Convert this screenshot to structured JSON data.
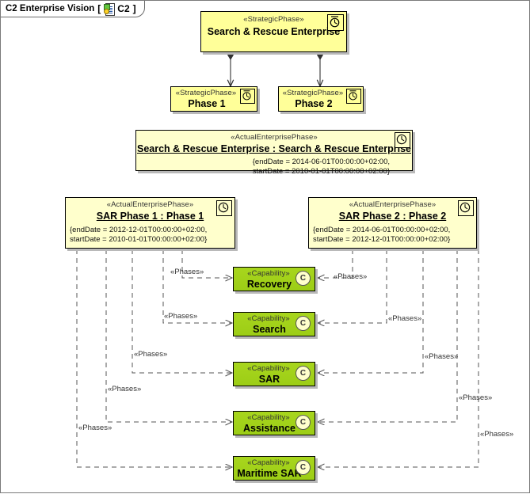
{
  "frame": {
    "title": "C2 Enterprise Vision",
    "bracket_open": "[",
    "bracket_close": "]",
    "tag": "C2",
    "icon": "diagram-document-icon"
  },
  "nodes": {
    "strategic_root": {
      "stereotype": "«StrategicPhase»",
      "name": "Search & Rescue Enterprise",
      "icon": "clock-icon"
    },
    "phase1": {
      "stereotype": "«StrategicPhase»",
      "name": "Phase 1",
      "icon": "clock-icon"
    },
    "phase2": {
      "stereotype": "«StrategicPhase»",
      "name": "Phase 2",
      "icon": "clock-icon"
    },
    "actual_enterprise": {
      "stereotype": "«ActualEnterprisePhase»",
      "name": "Search & Rescue Enterprise : Search & Rescue Enterprise",
      "prop_end": "{endDate = 2014-06-01T00:00:00+02:00,",
      "prop_start": "startDate = 2010-01-01T00:00:00+02:00}",
      "icon": "clock-icon"
    },
    "sar_phase1": {
      "stereotype": "«ActualEnterprisePhase»",
      "name": "SAR Phase 1 : Phase 1",
      "prop_end": "{endDate = 2012-12-01T00:00:00+02:00,",
      "prop_start": "startDate = 2010-01-01T00:00:00+02:00}",
      "icon": "clock-icon"
    },
    "sar_phase2": {
      "stereotype": "«ActualEnterprisePhase»",
      "name": "SAR Phase 2 : Phase 2",
      "prop_end": "{endDate = 2014-06-01T00:00:00+02:00,",
      "prop_start": "startDate = 2012-12-01T00:00:00+02:00}",
      "icon": "clock-icon"
    }
  },
  "capabilities": [
    {
      "stereotype": "«Capability»",
      "name": "Recovery",
      "badge": "C"
    },
    {
      "stereotype": "«Capability»",
      "name": "Search",
      "badge": "C"
    },
    {
      "stereotype": "«Capability»",
      "name": "SAR",
      "badge": "C"
    },
    {
      "stereotype": "«Capability»",
      "name": "Assistance",
      "badge": "C"
    },
    {
      "stereotype": "«Capability»",
      "name": "Maritime SAR",
      "badge": "C"
    }
  ],
  "edge_labels": {
    "left": [
      "«Phases»",
      "«Phases»",
      "«Phases»",
      "«Phases»",
      "«Phases»"
    ],
    "right": [
      "«Phases»",
      "«Phases»",
      "«Phases»",
      "«Phases»",
      "«Phases»"
    ]
  },
  "colors": {
    "strategic_fill": "#ffff99",
    "actual_fill": "#ffffcc",
    "capability_fill": "#9ccd16",
    "line": "#555555",
    "border": "#000000",
    "canvas": "#ffffff"
  }
}
